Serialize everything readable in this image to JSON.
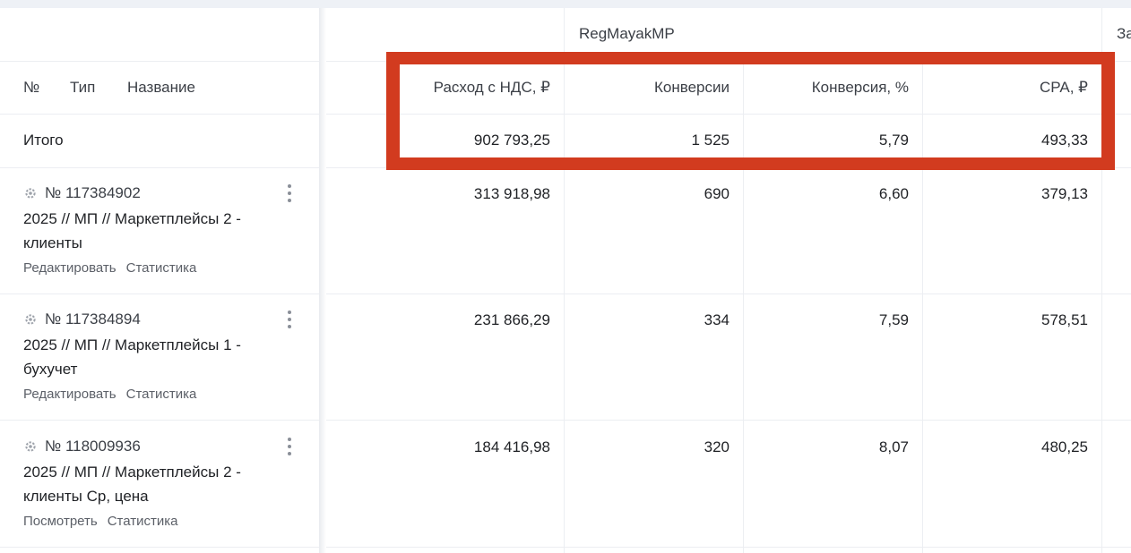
{
  "group": {
    "title": "RegMayakMP",
    "next_title": "За"
  },
  "left_header": {
    "num": "№",
    "type": "Тип",
    "name": "Название"
  },
  "metrics_header": {
    "spend": "Расход с НДС, ₽",
    "conversions": "Конверсии",
    "conv_rate": "Конверсия, %",
    "cpa": "CPA, ₽"
  },
  "totals": {
    "label": "Итого",
    "spend": "902 793,25",
    "conversions": "1 525",
    "conv_rate": "5,79",
    "cpa": "493,33"
  },
  "campaigns": [
    {
      "id": "№ 117384902",
      "name": "2025 // МП // Маркетплейсы 2 - клиенты",
      "action1": "Редактировать",
      "action2": "Статистика",
      "spend": "313 918,98",
      "conversions": "690",
      "conv_rate": "6,60",
      "cpa": "379,13"
    },
    {
      "id": "№ 117384894",
      "name": "2025 // МП // Маркетплейсы 1 - бухучет",
      "action1": "Редактировать",
      "action2": "Статистика",
      "spend": "231 866,29",
      "conversions": "334",
      "conv_rate": "7,59",
      "cpa": "578,51"
    },
    {
      "id": "№ 118009936",
      "name": "2025 // МП // Маркетплейсы 2 - клиенты Ср, цена",
      "action1": "Посмотреть",
      "action2": "Статистика",
      "spend": "184 416,98",
      "conversions": "320",
      "conv_rate": "8,07",
      "cpa": "480,25"
    }
  ],
  "colors": {
    "highlight": "#d23b1f",
    "grid": "#eceef2",
    "muted_text": "#5c6068"
  },
  "icons": {
    "campaign_type": "target-icon",
    "row_menu": "kebab-menu-icon"
  }
}
